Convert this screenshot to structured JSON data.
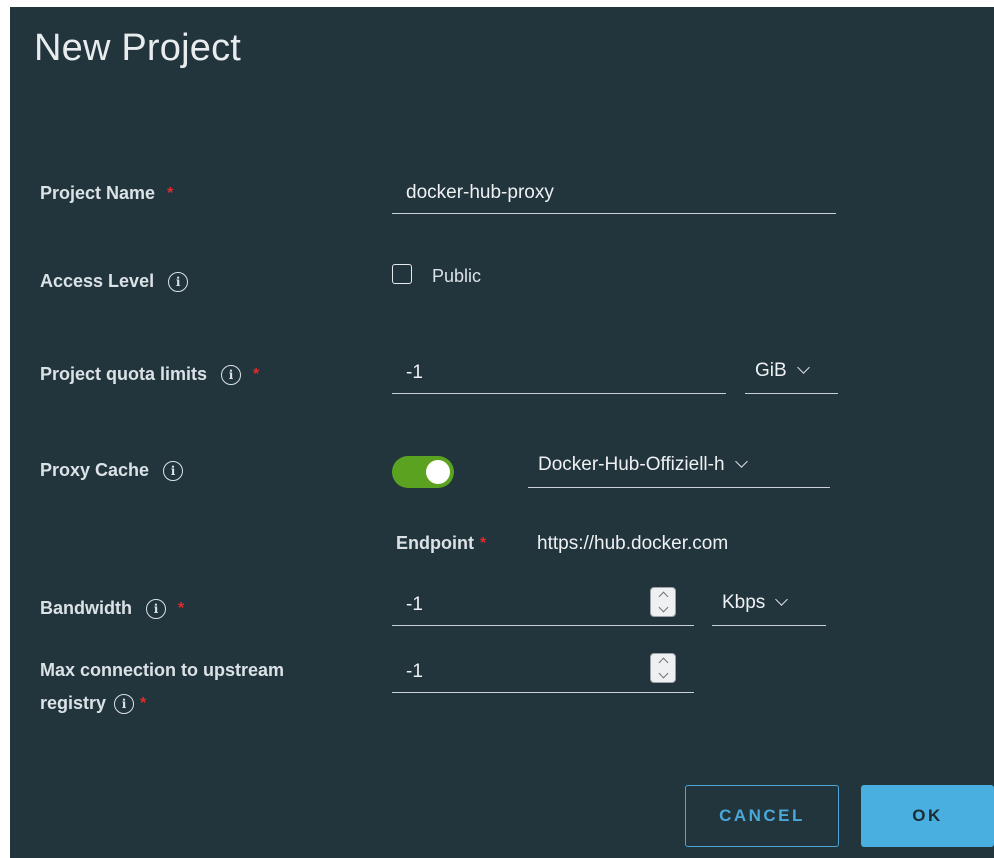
{
  "dialog": {
    "title": "New Project"
  },
  "fields": {
    "project_name": {
      "label": "Project Name",
      "required": "*",
      "value": "docker-hub-proxy"
    },
    "access_level": {
      "label": "Access Level",
      "checkbox_label": "Public",
      "checked": false
    },
    "quota": {
      "label": "Project quota limits",
      "required": "*",
      "value": "-1",
      "unit": "GiB"
    },
    "proxy_cache": {
      "label": "Proxy Cache",
      "enabled": true,
      "registry": "Docker-Hub-Offiziell-h"
    },
    "endpoint": {
      "label": "Endpoint",
      "required": "*",
      "value": "https://hub.docker.com"
    },
    "bandwidth": {
      "label": "Bandwidth",
      "required": "*",
      "value": "-1",
      "unit": "Kbps"
    },
    "max_connection": {
      "label_line1": "Max connection to upstream",
      "label_line2": "registry",
      "required": "*",
      "value": "-1"
    }
  },
  "buttons": {
    "cancel": "CANCEL",
    "ok": "OK"
  },
  "icons": {
    "info": "i"
  },
  "colors": {
    "background": "#22343c",
    "required": "#e02b2b",
    "toggle_on": "#5aa220",
    "primary": "#49aee0"
  }
}
